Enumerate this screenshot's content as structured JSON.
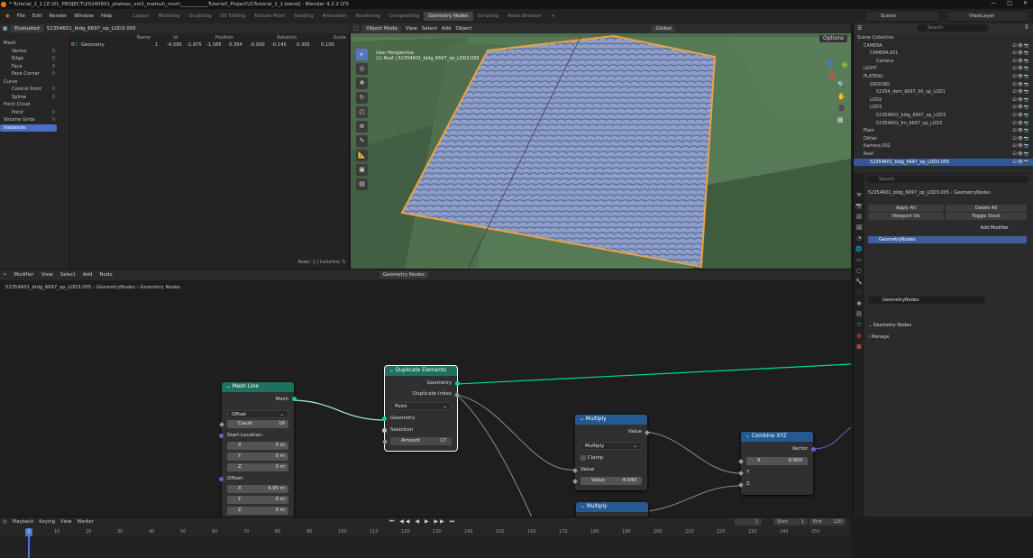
{
  "titlebar": {
    "title": "* Tutorial_2_1 [Z:\\01_PROJECT\\20240601_plateau_vol2_matsui\\_mori\\___________Tutorial\\_Project\\2\\Tutorial_2_1.blend] - Blender 4.2.2 LTS"
  },
  "menus": [
    "File",
    "Edit",
    "Render",
    "Window",
    "Help"
  ],
  "workspaces": [
    "Layout",
    "Modeling",
    "Sculpting",
    "UV Editing",
    "Texture Paint",
    "Shading",
    "Animation",
    "Rendering",
    "Compositing",
    "Geometry Nodes",
    "Scripting",
    "Asset Browser"
  ],
  "active_workspace_index": 9,
  "scene": "Scene",
  "view_layer": "ViewLayer",
  "spreadsheet": {
    "mode": "Evaluated",
    "object": "52354601_bldg_6697_op_LOD3.005",
    "sidebar": [
      {
        "label": "Mesh",
        "count": "",
        "indent": 0
      },
      {
        "label": "Vertex",
        "count": "0",
        "indent": 1
      },
      {
        "label": "Edge",
        "count": "0",
        "indent": 1
      },
      {
        "label": "Face",
        "count": "0",
        "indent": 1
      },
      {
        "label": "Face Corner",
        "count": "0",
        "indent": 1
      },
      {
        "label": "Curve",
        "count": "",
        "indent": 0
      },
      {
        "label": "Control Point",
        "count": "0",
        "indent": 1
      },
      {
        "label": "Spline",
        "count": "0",
        "indent": 1
      },
      {
        "label": "Point Cloud",
        "count": "",
        "indent": 0
      },
      {
        "label": "Point",
        "count": "0",
        "indent": 1
      },
      {
        "label": "Volume Grids",
        "count": "0",
        "indent": 0
      },
      {
        "label": "Instances",
        "count": "1",
        "indent": 0
      }
    ],
    "columns": [
      "Name",
      "Id",
      "Position",
      "Rotation",
      "Scale"
    ],
    "row": {
      "index": "0",
      "name": "Geometry",
      "id": "1",
      "pos": [
        "-4.590",
        "-2.975",
        "-1.585"
      ],
      "rot": [
        "0.354",
        "-0.000",
        "-0.145"
      ],
      "scale": [
        "0.305",
        "0.100"
      ]
    },
    "footer": "Rows: 1  |  Columns: 5"
  },
  "viewport": {
    "mode": "Object Mode",
    "menus": [
      "View",
      "Select",
      "Add",
      "Object"
    ],
    "orientation": "Global",
    "perspective": "User Perspective",
    "info": "(1) Roof | 52354601_bldg_6697_op_LOD3.005",
    "options": "Options"
  },
  "outliner": {
    "search": "Search",
    "items": [
      {
        "label": "Scene Collection",
        "indent": 0
      },
      {
        "label": "CAMERA",
        "indent": 1
      },
      {
        "label": "CAMERA.001",
        "indent": 2
      },
      {
        "label": "Camera",
        "indent": 3
      },
      {
        "label": "LIGHT",
        "indent": 1
      },
      {
        "label": "PLATEAU",
        "indent": 1
      },
      {
        "label": "GROUND",
        "indent": 2
      },
      {
        "label": "52354_dem_6697_00_op_LOD1",
        "indent": 3
      },
      {
        "label": "LOD2",
        "indent": 2
      },
      {
        "label": "LOD3",
        "indent": 2
      },
      {
        "label": "52354601_bldg_6697_op_LOD3",
        "indent": 3
      },
      {
        "label": "52354601_frn_6697_op_LOD3",
        "indent": 3
      },
      {
        "label": "Plain",
        "indent": 1
      },
      {
        "label": "Dither",
        "indent": 1
      },
      {
        "label": "Kamera.002",
        "indent": 1
      },
      {
        "label": "Roof",
        "indent": 1
      },
      {
        "label": "52354601_bldg_6697_op_LOD3.005",
        "indent": 2
      }
    ],
    "selected_index": 16
  },
  "properties": {
    "object": "52354601_bldg_6697_op_LOD3.005",
    "modifier_crumb": "GeometryNodes",
    "apply_all": "Apply All",
    "delete_all": "Delete All",
    "viewport_vis": "Viewport Vis",
    "toggle_stack": "Toggle Stack",
    "add_modifier": "Add Modifier",
    "modifier_name": "GeometryNodes",
    "node_group": "GeometryNodes",
    "panel_title": "Geometry Nodes",
    "manage": "Manage"
  },
  "node_editor": {
    "editor_type": "Modifier",
    "menus": [
      "View",
      "Select",
      "Add",
      "Node"
    ],
    "node_group": "Geometry Nodes",
    "breadcrumb": [
      "52354601_bldg_6697_op_LOD3.005",
      "GeometryNodes",
      "Geometry Nodes"
    ],
    "nodes": {
      "mesh_line": {
        "title": "Mesh Line",
        "out": "Mesh",
        "mode": "Offset",
        "count_label": "Count",
        "count": "16",
        "start": "Start Location:",
        "sx": "0 m",
        "sy": "0 m",
        "sz": "0 m",
        "offset": "Offset:",
        "ox": "4.95 m",
        "oy": "0 m",
        "oz": "0 m",
        "x": "X",
        "y": "Y",
        "z": "Z"
      },
      "duplicate": {
        "title": "Duplicate Elements",
        "out1": "Geometry",
        "out2": "Duplicate Index",
        "domain": "Point",
        "in1": "Geometry",
        "in2": "Selection",
        "amount_label": "Amount",
        "amount": "17"
      },
      "multiply1": {
        "title": "Multiply",
        "out": "Value",
        "op": "Multiply",
        "clamp": "Clamp",
        "in1": "Value",
        "in2_label": "Value",
        "in2": "4.040"
      },
      "multiply2": {
        "title": "Multiply"
      },
      "combine": {
        "title": "Combine XYZ",
        "out": "Vector",
        "x_label": "X",
        "x": "0.000",
        "y": "Y",
        "z": "Z"
      }
    }
  },
  "timeline": {
    "menus": [
      "Playback",
      "Keying",
      "View",
      "Marker"
    ],
    "current": "1",
    "start_label": "Start",
    "start": "1",
    "end_label": "End",
    "end": "120",
    "ticks": [
      "10",
      "20",
      "30",
      "40",
      "50",
      "60",
      "70",
      "80",
      "90",
      "100",
      "110",
      "120",
      "130",
      "140",
      "150",
      "160",
      "170",
      "180",
      "190",
      "200",
      "210",
      "220",
      "230",
      "240",
      "250"
    ],
    "playhead": "1"
  },
  "colors": {
    "accent": "#4a7bd8",
    "geometry_socket": "#00d6a3",
    "vector_socket": "#6363c7",
    "node_geometry_header": "#1d725e",
    "node_math_header": "#245a91",
    "selection_orange": "#f0a040"
  }
}
